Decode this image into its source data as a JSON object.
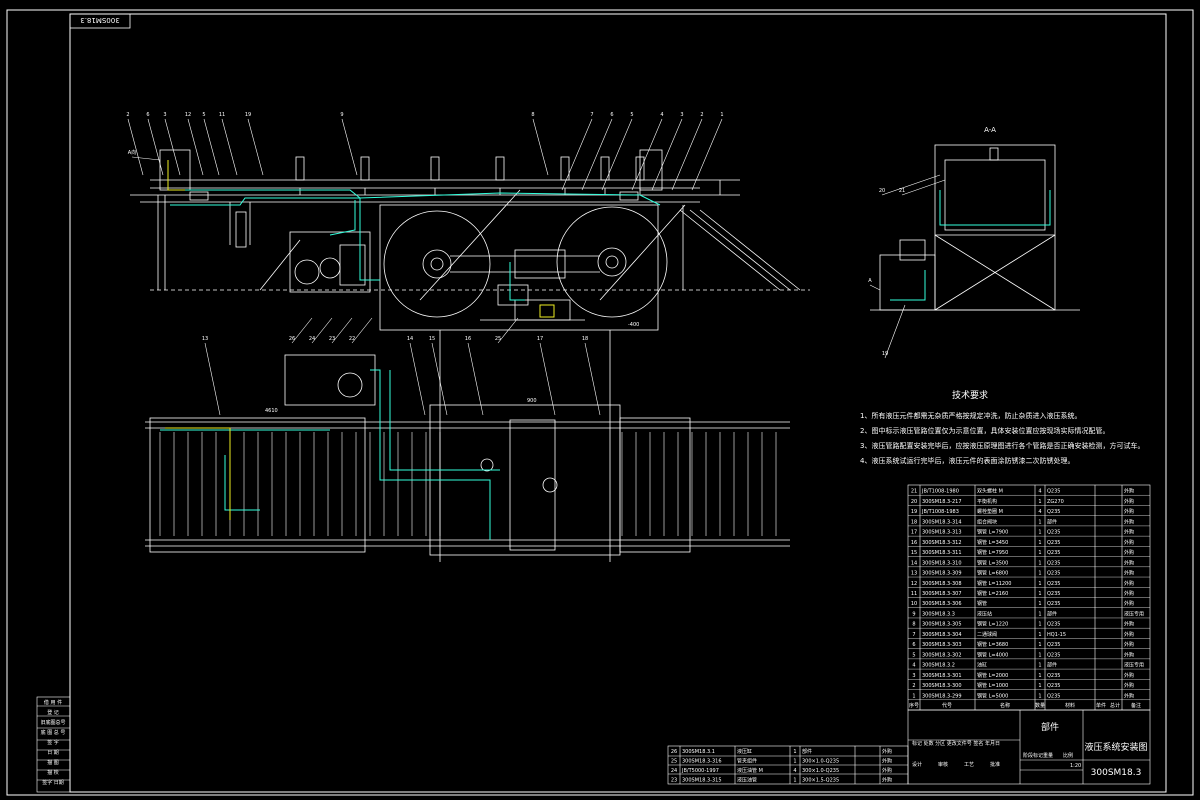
{
  "frame": {
    "drawing_no_rotated": "300SM18.3"
  },
  "notes": {
    "title": "技术要求",
    "items": [
      "1、所有液压元件都需无杂质严格按规定冲洗，防止杂质进入液压系统。",
      "2、图中标示液压管路位置仅为示意位置，具体安装位置应按现场实际情况配管。",
      "3、液压管路配置安装完毕后，应按液压原理图进行各个管路是否正确安装检测，方可试车。",
      "4、液压系统试运行完毕后，液压元件的表面涂防锈漆二次防锈处理。"
    ]
  },
  "view_labels": {
    "section": "A-A",
    "dim_left": "4610",
    "dim_right": "-400",
    "dim_plan_top": "900"
  },
  "balloons_top_left": [
    "2",
    "6",
    "3",
    "12",
    "5",
    "11",
    "19",
    "9",
    "8"
  ],
  "balloons_top_right": [
    "7",
    "6",
    "5",
    "4",
    "3",
    "2",
    "1"
  ],
  "balloons_plan": [
    "13",
    "14",
    "15",
    "16",
    "17",
    "18"
  ],
  "balloons_plan2": [
    "26",
    "24",
    "23",
    "22",
    "25"
  ],
  "balloons_side": [
    "20",
    "21",
    "19"
  ],
  "side_labels": [
    "A向",
    "A"
  ],
  "bom_header": {
    "seq": "序号",
    "code": "代号",
    "name": "名称",
    "qty": "数量",
    "material": "材料",
    "unit_w": "单件",
    "total_w": "总计",
    "weight": "重量",
    "note": "备注"
  },
  "bom_rows": [
    [
      "21",
      "JB/T1008-1980",
      "双头螺柱 M",
      "4",
      "Q235",
      "外购"
    ],
    [
      "20",
      "300SM18.3-217",
      "平衡机构",
      "1",
      "ZG270",
      "外购"
    ],
    [
      "19",
      "JB/T1008-1983",
      "螺栓垫圈 M",
      "4",
      "Q235",
      "外购"
    ],
    [
      "18",
      "300SM18.3-314",
      "组合阀块",
      "1",
      "部件",
      "外购"
    ],
    [
      "17",
      "300SM18.3-313",
      "钢管 L=7900",
      "1",
      "Q235",
      "外购"
    ],
    [
      "16",
      "300SM18.3-312",
      "钢管 L=3450",
      "1",
      "Q235",
      "外购"
    ],
    [
      "15",
      "300SM18.3-311",
      "钢管 L=7950",
      "1",
      "Q235",
      "外购"
    ],
    [
      "14",
      "300SM18.3-310",
      "钢管 L=3500",
      "1",
      "Q235",
      "外购"
    ],
    [
      "13",
      "300SM18.3-309",
      "钢管 L=6800",
      "1",
      "Q235",
      "外购"
    ],
    [
      "12",
      "300SM18.3-308",
      "钢管 L=11200",
      "1",
      "Q235",
      "外购"
    ],
    [
      "11",
      "300SM18.3-307",
      "钢管 L=2160",
      "1",
      "Q235",
      "外购"
    ],
    [
      "10",
      "300SM18.3-306",
      "钢管",
      "1",
      "Q235",
      "外购"
    ],
    [
      "9",
      "300SM18.3.3",
      "液压站",
      "1",
      "部件",
      "液压专用"
    ],
    [
      "8",
      "300SM18.3-305",
      "钢管 L=1220",
      "1",
      "Q235",
      "外购"
    ],
    [
      "7",
      "300SM18.3-304",
      "二通球阀",
      "1",
      "HQ1-15",
      "外购"
    ],
    [
      "6",
      "300SM18.3-303",
      "钢管 L=3680",
      "1",
      "Q235",
      "外购"
    ],
    [
      "5",
      "300SM18.3-302",
      "钢管 L=4000",
      "1",
      "Q235",
      "外购"
    ],
    [
      "4",
      "300SM18.3.2",
      "油缸",
      "1",
      "部件",
      "液压专用"
    ],
    [
      "3",
      "300SM18.3-301",
      "钢管 L=2000",
      "1",
      "Q235",
      "外购"
    ],
    [
      "2",
      "300SM18.3-300",
      "钢管 L=1000",
      "1",
      "Q235",
      "外购"
    ],
    [
      "1",
      "300SM18.3-299",
      "钢管 L=5000",
      "1",
      "Q235",
      "外购"
    ]
  ],
  "lower_rows": [
    [
      "26",
      "300SM18.3.1",
      "液压缸",
      "1",
      "部件",
      "外购"
    ],
    [
      "25",
      "300SM18.3-316",
      "管夹组件",
      "1",
      "300×1.0-Q235",
      "外购"
    ],
    [
      "24",
      "JB/T5000-1997",
      "液压油管 M",
      "4",
      "300×1.0-Q235",
      "外购"
    ],
    [
      "23",
      "300SM18.3-315",
      "液压油管",
      "1",
      "300×1.5-Q235",
      "外购"
    ]
  ],
  "title_block": {
    "part": "部件",
    "title": "液压系统安装图",
    "drawing_no": "300SM18.3",
    "scale": "1:20",
    "rev": "标记 处数 分区 更改文件号 签名 年月日",
    "roles": [
      "设计",
      "审核",
      "工艺",
      "批准"
    ],
    "stages": [
      "阶段标记",
      "重量",
      "比例"
    ]
  },
  "left_strip": [
    "借 用 件",
    "登 记",
    "旧底图总号",
    "底 图 总 号",
    "签 字",
    "日 期",
    "描 图",
    "描 校",
    "签字 日期"
  ]
}
